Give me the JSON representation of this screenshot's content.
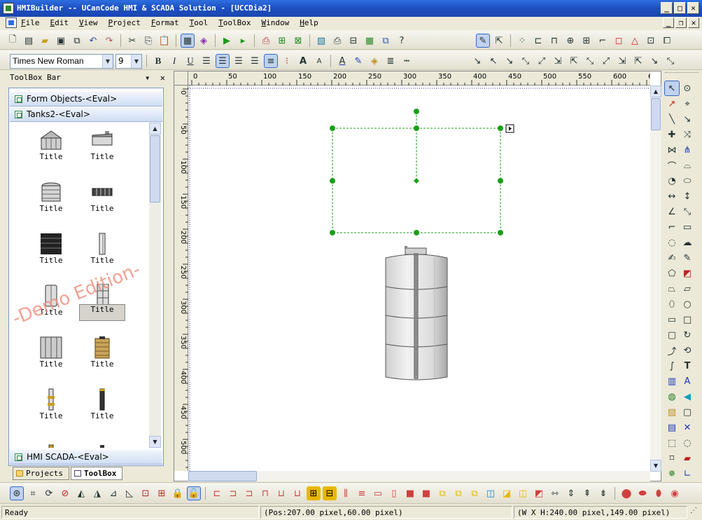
{
  "window": {
    "title": "HMIBuilder -- UCanCode HMI & SCADA Solution - [UCCDia2]"
  },
  "menu": [
    "File",
    "Edit",
    "View",
    "Project",
    "Format",
    "Tool",
    "ToolBox",
    "Window",
    "Help"
  ],
  "format": {
    "font": "Times New Roman",
    "size": "9"
  },
  "toolbox": {
    "header": "ToolBox Bar",
    "groups": {
      "form": "Form Objects-<Eval>",
      "tanks": "Tanks2-<Eval>",
      "scada": "HMI SCADA-<Eval>"
    },
    "items": [
      "Title",
      "Title",
      "Title",
      "Title",
      "Title",
      "Title",
      "Title",
      "Title",
      "Title",
      "Title",
      "Title",
      "Title"
    ],
    "watermark": "-Demo Edition-"
  },
  "tabs": {
    "projects": "Projects",
    "toolbox": "ToolBox"
  },
  "ruler": {
    "h": [
      "0",
      "50",
      "100",
      "150",
      "200",
      "250",
      "300",
      "350",
      "400",
      "450",
      "500",
      "550",
      "600",
      "6"
    ],
    "v": [
      "0",
      "50",
      "100",
      "150",
      "200",
      "250",
      "300",
      "350",
      "400",
      "450",
      "500"
    ]
  },
  "status": {
    "ready": "Ready",
    "pos": "(Pos:207.00 pixel,60.00 pixel)",
    "size": "(W X H:240.00 pixel,149.00 pixel)"
  },
  "colors": {
    "selection": "#1aa01a",
    "titlebar": "#1c4fc0"
  }
}
